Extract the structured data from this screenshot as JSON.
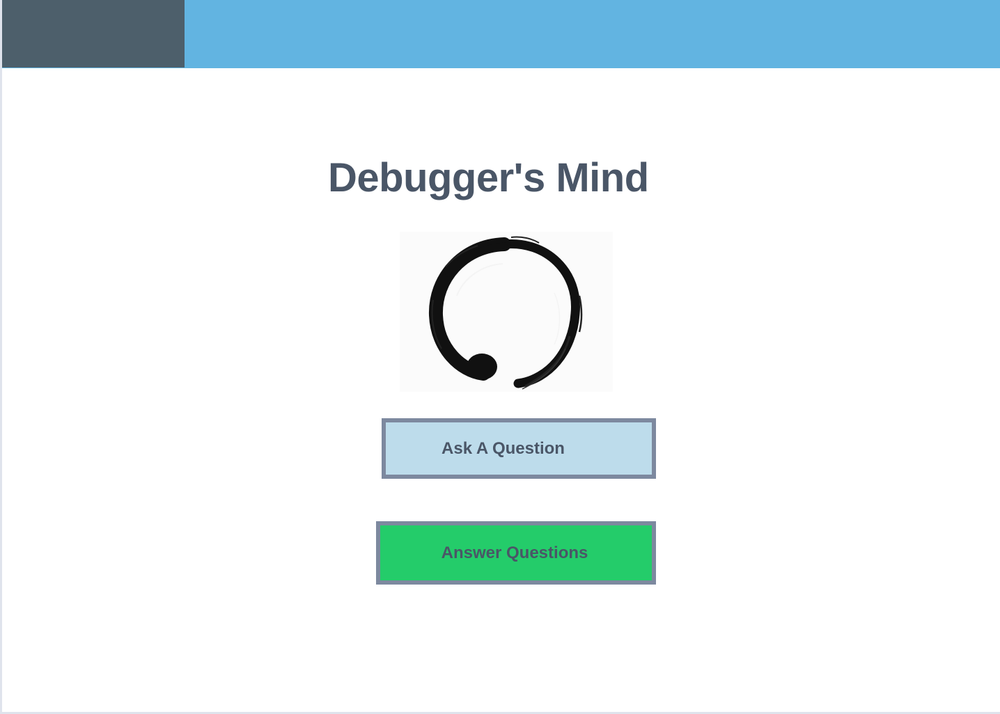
{
  "header": {
    "bar_color": "#62b4e1",
    "block_color": "#4d5f6b"
  },
  "main": {
    "title": "Debugger's Mind",
    "logo": {
      "icon": "enso-circle-icon"
    },
    "buttons": {
      "ask_label": "Ask A Question",
      "ask_color": "#bddceb",
      "answer_label": "Answer Questions",
      "answer_color": "#24cc6a"
    }
  }
}
